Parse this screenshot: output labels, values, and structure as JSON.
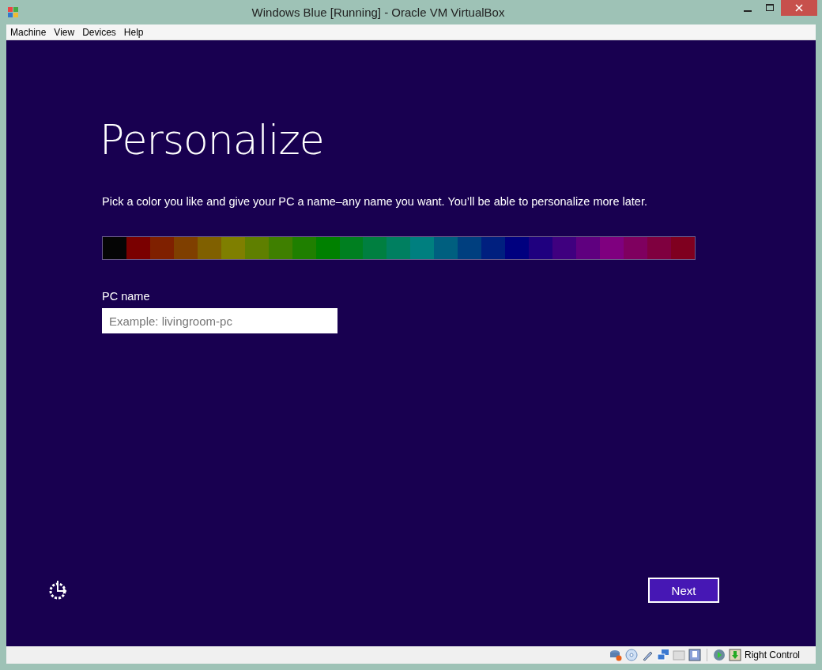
{
  "window": {
    "title": "Windows Blue [Running] - Oracle VM VirtualBox"
  },
  "menu": [
    "Machine",
    "View",
    "Devices",
    "Help"
  ],
  "screen": {
    "heading": "Personalize",
    "description": "Pick a color you like and give your PC a name–any name you want. You’ll be able to personalize more later.",
    "swatches": [
      {
        "color": "#050505"
      },
      {
        "color": "#7a0000"
      },
      {
        "color": "#7f2000"
      },
      {
        "color": "#7f3f00"
      },
      {
        "color": "#806000"
      },
      {
        "color": "#7f7f00"
      },
      {
        "color": "#5f7f00"
      },
      {
        "color": "#3f7f00"
      },
      {
        "color": "#1f7f00"
      },
      {
        "color": "#008000"
      },
      {
        "color": "#007f20"
      },
      {
        "color": "#007f40"
      },
      {
        "color": "#007f60"
      },
      {
        "color": "#007f7f"
      },
      {
        "color": "#005f7f"
      },
      {
        "color": "#003f7f"
      },
      {
        "color": "#001f7f"
      },
      {
        "color": "#00007f"
      },
      {
        "color": "#1f007f"
      },
      {
        "color": "#3f007f"
      },
      {
        "color": "#5f007f"
      },
      {
        "color": "#7f007f"
      },
      {
        "color": "#7f005f"
      },
      {
        "color": "#7f003f"
      },
      {
        "color": "#7f001f"
      }
    ],
    "pc_name": {
      "label": "PC name",
      "placeholder": "Example: livingroom-pc"
    },
    "next_button": "Next"
  },
  "status_bar": {
    "host_key": "Right Control"
  }
}
